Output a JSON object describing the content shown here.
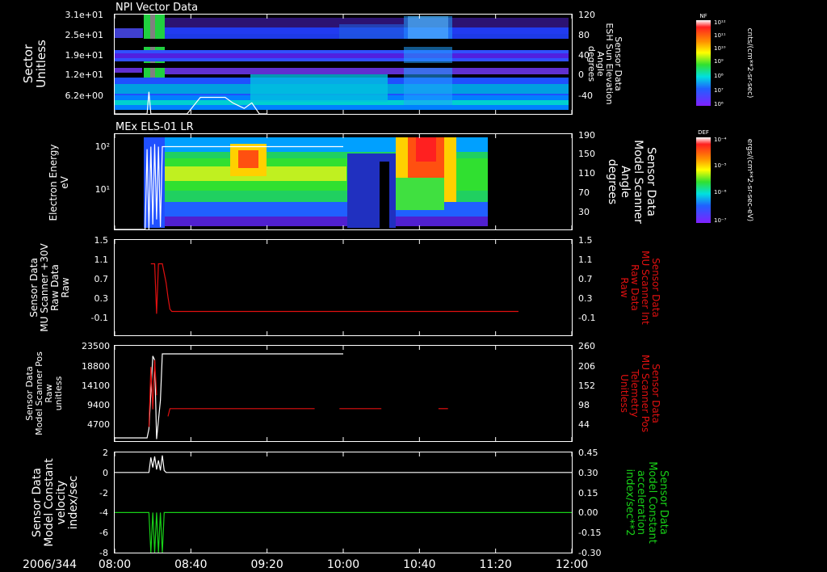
{
  "chart_data": [
    {
      "type": "heatmap",
      "title": "NPI Vector Data",
      "ylabel_left": [
        "Sector",
        "Unitless"
      ],
      "yticks_left": [
        "3.1e+01",
        "2.5e+01",
        "1.9e+01",
        "1.2e+01",
        "6.2e+00"
      ],
      "ylabel_right": [
        "Sensor Data",
        "ESH Sun Elevation",
        "Angle",
        "degrees"
      ],
      "yticks_right": [
        "120",
        "80",
        "40",
        "0",
        "-40"
      ],
      "ylim_right": [
        -60,
        120
      ],
      "colorbar": {
        "label": "NF",
        "unit": "cnts/(cm**2-sr-sec)",
        "ticks": [
          "10¹²",
          "10¹¹",
          "10¹⁰",
          "10⁹",
          "10⁸",
          "10⁷",
          "10⁶"
        ]
      },
      "overlay_line": {
        "color": "#ffffff",
        "x": [
          0,
          17,
          18,
          19,
          20,
          25,
          38,
          45,
          50,
          58,
          62,
          68,
          72,
          76,
          80
        ],
        "y": [
          -60,
          -60,
          -20,
          -60,
          -60,
          -60,
          -60,
          -30,
          -30,
          -30,
          -40,
          -50,
          -40,
          -60,
          -60
        ]
      }
    },
    {
      "type": "heatmap",
      "title": "MEx ELS-01 LR",
      "ylabel_left": [
        "Electron Energy",
        "eV"
      ],
      "yticks_left": [
        "10²",
        "10¹"
      ],
      "ylabel_right": [
        "Sensor Data",
        "Model Scanner",
        "Angle",
        "degrees"
      ],
      "yticks_right": [
        "190",
        "150",
        "110",
        "70",
        "30"
      ],
      "ylim_right": [
        0,
        190
      ],
      "colorbar": {
        "label": "DEF",
        "unit": "ergs/(cm**2-sr-sec-eV)",
        "ticks": [
          "10⁻⁴",
          "10⁻⁵",
          "10⁻⁶",
          "10⁻⁷"
        ]
      },
      "overlay_line": {
        "color": "#ffffff",
        "x": [
          0,
          16,
          17,
          18,
          19,
          20,
          21,
          22,
          23,
          24,
          25,
          60,
          120
        ],
        "y": [
          0,
          0,
          160,
          0,
          165,
          10,
          170,
          20,
          165,
          5,
          165,
          165,
          165
        ]
      }
    },
    {
      "type": "line",
      "xlim": [
        0,
        240
      ],
      "ylabel_left": [
        "Sensor Data",
        "MU Scanner +30V",
        "Raw Data",
        "Raw"
      ],
      "yticks_left": [
        "1.5",
        "1.1",
        "0.7",
        "0.3",
        "-0.1"
      ],
      "ylim_left": [
        -0.5,
        1.5
      ],
      "ylabel_right": [
        "Sensor Data",
        "MU Scanner Int",
        "Raw Data",
        "Raw"
      ],
      "yticks_right": [
        "1.5",
        "1.1",
        "0.7",
        "0.3",
        "-0.1"
      ],
      "series": [
        {
          "color": "#e01010",
          "x": [
            19,
            21,
            22,
            23,
            25,
            27,
            28,
            29,
            30,
            35,
            40,
            45,
            60,
            120,
            180,
            212
          ],
          "y": [
            1.0,
            1.0,
            -0.05,
            1.0,
            1.0,
            0.6,
            0.3,
            0.05,
            0.0,
            0.0,
            0.0,
            0.0,
            0.0,
            0.0,
            0.0,
            0.0
          ]
        }
      ]
    },
    {
      "type": "line",
      "ylabel_left": [
        "Sensor Data",
        "Model Scanner Pos",
        "Raw",
        "unitless"
      ],
      "yticks_left": [
        "23500",
        "18800",
        "14100",
        "9400",
        "4700"
      ],
      "ylim_left": [
        0,
        23500
      ],
      "ylabel_right": [
        "Sensor Data",
        "MU Scanner Pos",
        "Telemetry",
        "Unitless"
      ],
      "yticks_right": [
        "260",
        "206",
        "152",
        "98",
        "44"
      ],
      "ylim_right": [
        -10,
        260
      ],
      "series": [
        {
          "color": "#ffffff",
          "x": [
            0,
            17,
            18,
            20,
            21,
            22,
            24,
            25,
            26,
            27,
            120
          ],
          "y": [
            800,
            800,
            3000,
            21000,
            20000,
            500,
            10000,
            21500,
            21500,
            21500,
            21500
          ]
        },
        {
          "color": "#e01010",
          "segments": [
            {
              "x": [
                18,
                19,
                20,
                21,
                22
              ],
              "y": [
                30,
                200,
                80,
                220,
                120
              ]
            },
            {
              "x": [
                28,
                29,
                105
              ],
              "y": [
                60,
                82,
                82
              ]
            },
            {
              "x": [
                118,
                140
              ],
              "y": [
                82,
                82
              ]
            },
            {
              "x": [
                170,
                175
              ],
              "y": [
                82,
                82
              ]
            }
          ]
        }
      ]
    },
    {
      "type": "line",
      "ylabel_left": [
        "Sensor Data",
        "Model Constant",
        "velocity",
        "index/sec"
      ],
      "yticks_left": [
        "2",
        "0",
        "-2",
        "-4",
        "-6",
        "-8"
      ],
      "ylim_left": [
        -8,
        2
      ],
      "ylabel_right": [
        "Sensor Data",
        "Model Constant",
        "acceleration",
        "index/sec**2"
      ],
      "yticks_right": [
        "0.45",
        "0.30",
        "0.15",
        "0.00",
        "-0.15",
        "-0.30"
      ],
      "ylim_right": [
        -0.3,
        0.45
      ],
      "series": [
        {
          "color": "#ffffff",
          "x": [
            0,
            18,
            19,
            20,
            21,
            22,
            23,
            24,
            25,
            26,
            27,
            240
          ],
          "y": [
            0,
            0,
            1.5,
            0.5,
            1.6,
            0.3,
            1.2,
            0.2,
            1.7,
            0.2,
            0,
            0
          ]
        },
        {
          "color": "#18d018",
          "x": [
            0,
            18,
            19,
            20,
            21,
            22,
            23,
            24,
            25,
            26,
            27,
            240
          ],
          "y": [
            0,
            0,
            -0.3,
            0,
            -0.3,
            0,
            -0.3,
            0,
            -0.3,
            0,
            0,
            0
          ]
        }
      ]
    }
  ],
  "time_axis": {
    "date_label": "2006/344",
    "ticks": [
      "08:00",
      "08:40",
      "09:20",
      "10:00",
      "10:40",
      "11:20",
      "12:00"
    ],
    "tick_minutes": [
      0,
      40,
      80,
      120,
      160,
      200,
      240
    ]
  },
  "colors": {
    "background": "#000000",
    "frame": "#ffffff",
    "red_label": "#e01010",
    "green_label": "#18d018"
  }
}
